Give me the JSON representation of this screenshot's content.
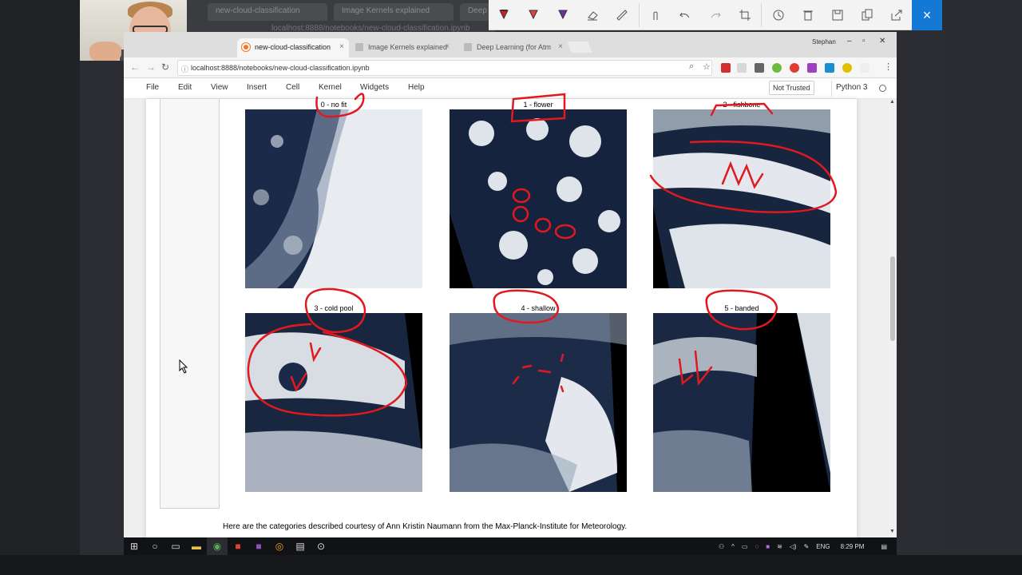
{
  "back_window": {
    "tabs": [
      "new-cloud-classification",
      "Image Kernels explained",
      "Deep"
    ],
    "url": "localhost:8888/notebooks/new-cloud-classification.ipynb"
  },
  "annotation_toolbar": {
    "tools": [
      "red-pen-icon",
      "red-pen-2-icon",
      "purple-highlighter-icon",
      "eraser-icon",
      "ruler-icon",
      "touch-write-icon",
      "undo-icon",
      "redo-icon",
      "crop-icon",
      "history-icon",
      "delete-icon",
      "save-icon",
      "copy-icon",
      "share-icon"
    ],
    "close": "×",
    "accent": "#1479d4"
  },
  "browser": {
    "tabs": [
      {
        "label": "new-cloud-classification",
        "active": true,
        "fav_color": "#f37626"
      },
      {
        "label": "Image Kernels explained",
        "active": false,
        "fav_color": "#999999"
      },
      {
        "label": "Deep Learning (for Atm",
        "active": false,
        "fav_color": "#999999"
      }
    ],
    "user": "Stephan",
    "url": "localhost:8888/notebooks/new-cloud-classification.ipynb",
    "ext_colors": [
      "#d03030",
      "#cccccc",
      "#555555",
      "#6cbb3c",
      "#e03c31",
      "#a040c0",
      "#1a8fd0",
      "#e0c000",
      "#cccccc"
    ]
  },
  "jupyter": {
    "menu": [
      "File",
      "Edit",
      "View",
      "Insert",
      "Cell",
      "Kernel",
      "Widgets",
      "Help"
    ],
    "trust": "Not Trusted",
    "kernel": "Python 3"
  },
  "panels": [
    {
      "title": "0 - no fit"
    },
    {
      "title": "1 - flower"
    },
    {
      "title": "2 - fishbone"
    },
    {
      "title": "3 - cold pool"
    },
    {
      "title": "4 - shallow"
    },
    {
      "title": "5 - banded"
    }
  ],
  "caption": "Here are the categories described courtesy of Ann Kristin Naumann from the Max-Planck-Institute for Meteorology.",
  "taskbar": {
    "lang": "ENG",
    "time": "8:29 PM"
  }
}
